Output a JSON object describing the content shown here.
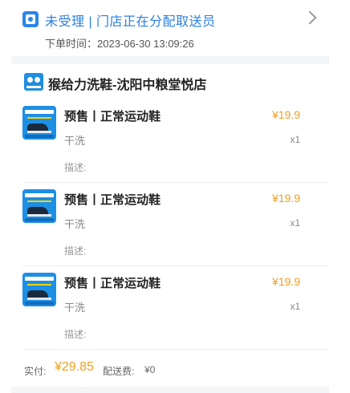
{
  "order": {
    "status": "未受理 | 门店正在分配取送员",
    "time_label": "下单时间：",
    "time_value": "2023-06-30 13:09:26"
  },
  "store": {
    "name": "猴给力洗鞋-沈阳中粮堂悦店"
  },
  "items": [
    {
      "title": "预售丨正常运动鞋",
      "price": "¥19.9",
      "service": "干洗",
      "quantity": "x1",
      "description_label": "描述:"
    },
    {
      "title": "预售丨正常运动鞋",
      "price": "¥19.9",
      "service": "干洗",
      "quantity": "x1",
      "description_label": "描述:"
    },
    {
      "title": "预售丨正常运动鞋",
      "price": "¥19.9",
      "service": "干洗",
      "quantity": "x1",
      "description_label": "描述:"
    }
  ],
  "summary": {
    "paid_label": "实付:",
    "paid_amount": "¥29.85",
    "delivery_label": "配送费:",
    "delivery_amount": "¥0"
  },
  "colors": {
    "accent_blue": "#2a7fe0",
    "price_orange": "#f0a020"
  },
  "icons": {
    "status": "order-status-icon",
    "chevron": "chevron-right-icon",
    "store": "store-logo-icon",
    "item": "shoe-thumbnail-icon"
  }
}
